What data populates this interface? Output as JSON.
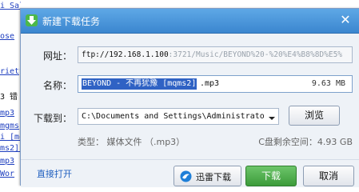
{
  "background_page": {
    "lines": [
      "i Salv",
      "ose",
      "",
      "",
      "riety",
      "3  错",
      "mp3",
      "mgms",
      "i  [mq",
      "ms2].",
      "mp3",
      "Wor"
    ]
  },
  "dialog": {
    "title": "新建下载任务",
    "close_label": "✕",
    "url_label": "网址：",
    "url_value_bright": "ftp://192.168.1.100",
    "url_value_dim": ":3721/Music/BEYOND%20-%20%E4%B8%8D%E5%",
    "name_label": "名称：",
    "name_selected": "BEYOND - 不再犹豫 [mqms2]",
    "name_ext": ".mp3",
    "name_size": "9.63 MB",
    "dir_label": "下载到：",
    "dir_value": "C:\\Documents and Settings\\Administrator\\",
    "browse_label": "浏览",
    "type_text": "类型： 媒体文件 （.mp3）",
    "free_space_text": "C盘剩余空间：4.93 GB",
    "direct_open_label": "直接打开",
    "xunlei_label": "迅雷下载",
    "download_label": "下载",
    "cancel_label": "取消"
  },
  "colors": {
    "titlebar": "#3b86cf",
    "download_button": "#3c9b3a",
    "selection": "#2f62c4",
    "link": "#1f5fbf"
  },
  "icons": {
    "title_icon": "green-down-arrow-icon",
    "xunlei_icon": "xunlei-bird-icon",
    "dropdown": "chevron-down-icon",
    "close": "close-icon"
  }
}
